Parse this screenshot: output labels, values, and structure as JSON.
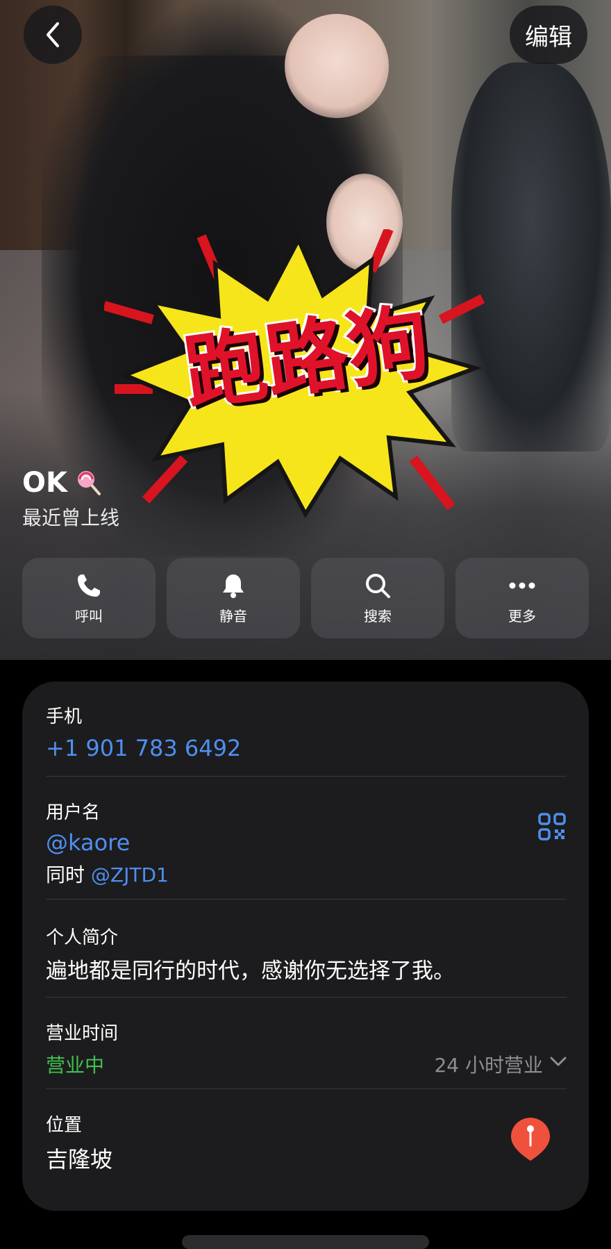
{
  "top_bar": {
    "edit_label": "编辑"
  },
  "sticker": {
    "text": "跑路狗"
  },
  "profile": {
    "name": "OK",
    "status": "最近曾上线"
  },
  "actions": [
    {
      "label": "呼叫",
      "icon": "phone-icon"
    },
    {
      "label": "静音",
      "icon": "bell-icon"
    },
    {
      "label": "搜索",
      "icon": "search-icon"
    },
    {
      "label": "更多",
      "icon": "more-icon"
    }
  ],
  "info": {
    "phone": {
      "label": "手机",
      "value": "+1 901 783 6492"
    },
    "username": {
      "label": "用户名",
      "value": "@kaore",
      "also_prefix": "同时",
      "also_value": "@ZJTD1"
    },
    "bio": {
      "label": "个人简介",
      "value": "遍地都是同行的时代，感谢你无选择了我。"
    },
    "hours": {
      "label": "营业时间",
      "status": "营业中",
      "detail": "24 小时营业"
    },
    "location": {
      "label": "位置",
      "value": "吉隆坡"
    }
  },
  "colors": {
    "link": "#4f8ff0",
    "open_green": "#3fc24f",
    "card_bg": "#1c1c1e",
    "pin_red": "#f0513d"
  }
}
